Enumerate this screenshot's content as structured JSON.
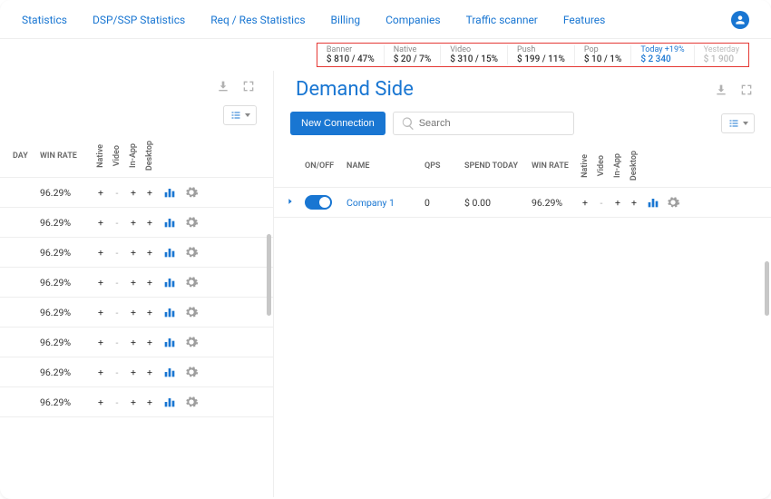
{
  "nav": {
    "items": [
      "Statistics",
      "DSP/SSP Statistics",
      "Req / Res Statistics",
      "Billing",
      "Companies",
      "Traffic scanner",
      "Features"
    ]
  },
  "stats": {
    "banner": {
      "label": "Banner",
      "value": "$ 810 / 47%"
    },
    "native": {
      "label": "Native",
      "value": "$ 20 / 7%"
    },
    "video": {
      "label": "Video",
      "value": "$ 310 / 15%"
    },
    "push": {
      "label": "Push",
      "value": "$ 199 / 11%"
    },
    "pop": {
      "label": "Pop",
      "value": "$ 10 / 1%"
    },
    "today": {
      "label": "Today +19%",
      "value": "$ 2 340"
    },
    "yesterday": {
      "label": "Yesterday",
      "value": "$ 1 900"
    }
  },
  "left": {
    "headers": {
      "day": "DAY",
      "win": "WIN RATE",
      "native": "Native",
      "video": "Video",
      "inapp": "In-App",
      "desktop": "Desktop"
    },
    "rows": [
      {
        "win": "96.29%",
        "native": "+",
        "video": "-",
        "inapp": "+",
        "desktop": "+"
      },
      {
        "win": "96.29%",
        "native": "+",
        "video": "-",
        "inapp": "+",
        "desktop": "+"
      },
      {
        "win": "96.29%",
        "native": "+",
        "video": "-",
        "inapp": "+",
        "desktop": "+"
      },
      {
        "win": "96.29%",
        "native": "+",
        "video": "-",
        "inapp": "+",
        "desktop": "+"
      },
      {
        "win": "96.29%",
        "native": "+",
        "video": "-",
        "inapp": "+",
        "desktop": "+"
      },
      {
        "win": "96.29%",
        "native": "+",
        "video": "-",
        "inapp": "+",
        "desktop": "+"
      },
      {
        "win": "96.29%",
        "native": "+",
        "video": "-",
        "inapp": "+",
        "desktop": "+"
      },
      {
        "win": "96.29%",
        "native": "+",
        "video": "-",
        "inapp": "+",
        "desktop": "+"
      }
    ]
  },
  "right": {
    "title": "Demand Side",
    "new_connection": "New Connection",
    "search_placeholder": "Search",
    "headers": {
      "onoff": "ON/OFF",
      "name": "NAME",
      "qps": "QPS",
      "spend": "SPEND TODAY",
      "win": "WIN RATE",
      "native": "Native",
      "video": "Video",
      "inapp": "In-App",
      "desktop": "Desktop"
    },
    "rows": [
      {
        "name": "Company 1",
        "qps": "0",
        "spend": "$ 0.00",
        "win": "96.29%",
        "native": "+",
        "video": "-",
        "inapp": "+",
        "desktop": "+"
      }
    ]
  }
}
